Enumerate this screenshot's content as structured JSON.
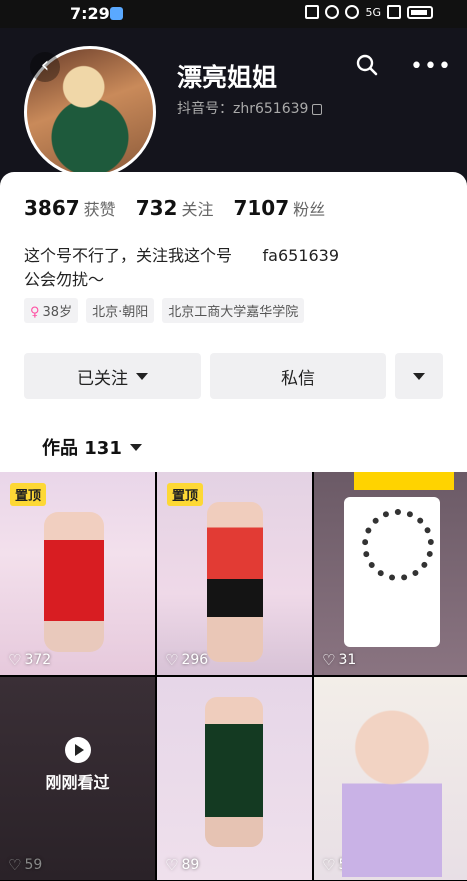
{
  "status_bar": {
    "time": "7:29",
    "network": "5G"
  },
  "profile": {
    "name": "漂亮姐姐",
    "douyin_id": "抖音号：zhr651639",
    "stats": [
      {
        "value": "3867",
        "label": "获赞"
      },
      {
        "value": "732",
        "label": "关注"
      },
      {
        "value": "7107",
        "label": "粉丝"
      }
    ],
    "bio_line1": "这个号不行了，关注我这个号      fa651639",
    "bio_line2": "公会勿扰～",
    "tags": {
      "age": "38岁",
      "location": "北京·朝阳",
      "school": "北京工商大学嘉华学院"
    }
  },
  "actions": {
    "followed_label": "已关注",
    "message_label": "私信"
  },
  "works": {
    "tab_label": "作品 131"
  },
  "videos": [
    {
      "pinned": "置顶",
      "likes": "372"
    },
    {
      "pinned": "置顶",
      "likes": "296"
    },
    {
      "pinned": "",
      "likes": "31"
    },
    {
      "pinned": "",
      "likes": "59",
      "overlay": "刚刚看过"
    },
    {
      "pinned": "",
      "likes": "89"
    },
    {
      "pinned": "",
      "likes": "50"
    }
  ]
}
